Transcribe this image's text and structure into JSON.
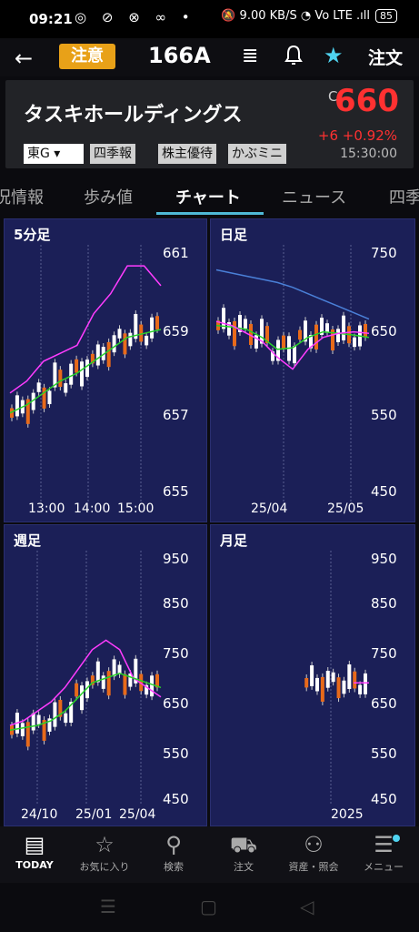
{
  "status_bar": {
    "time": "09:21",
    "left_icons": "◎ ⊘ ⊗ ∞ •",
    "right_icons": "🔕 9.00 KB/S ◔ Vo LTE .ıll",
    "battery": "85"
  },
  "header": {
    "back_glyph": "←",
    "badge": "注意",
    "code": "166A",
    "order": "注文",
    "doc_glyph": "≣",
    "bell_glyph": "♫",
    "star_glyph": "★"
  },
  "quote": {
    "name": "タスキホールディングス",
    "price_prefix": "C",
    "price": "660",
    "change": "+6  +0.92%",
    "time": "15:30:00",
    "tags": [
      "東G ▾",
      "四季報",
      "株主優待",
      "かぶミニ"
    ]
  },
  "tabs": [
    {
      "label": "況情報"
    },
    {
      "label": "歩み値"
    },
    {
      "label": "チャート"
    },
    {
      "label": "ニュース"
    },
    {
      "label": "四季"
    }
  ],
  "charts": [
    {
      "title": "5分足",
      "y_ticks": [
        "661",
        "659",
        "657",
        "655"
      ],
      "x_ticks": [
        "13:00",
        "14:00",
        "15:00"
      ]
    },
    {
      "title": "日足",
      "y_ticks": [
        "750",
        "650",
        "550",
        "450"
      ],
      "x_ticks": [
        "25/04",
        "25/05"
      ]
    },
    {
      "title": "週足",
      "y_ticks": [
        "950",
        "850",
        "750",
        "650",
        "550",
        "450"
      ],
      "x_ticks": [
        "24/10",
        "25/01",
        "25/04"
      ]
    },
    {
      "title": "月足",
      "y_ticks": [
        "950",
        "850",
        "750",
        "650",
        "550",
        "450"
      ],
      "x_ticks": [
        "2025"
      ]
    }
  ],
  "chart_data": [
    {
      "type": "line",
      "title": "5分足",
      "ylim": [
        655,
        661
      ],
      "series": [
        {
          "values": [
            657.5,
            657.8,
            658.3,
            658.5,
            658.7,
            659.5,
            660.0,
            660.7,
            660.7,
            660.2
          ]
        },
        {
          "values": [
            657.0,
            657.2,
            657.5,
            657.8,
            658.0,
            658.3,
            658.6,
            658.9,
            659.0,
            659.1
          ]
        }
      ]
    },
    {
      "type": "line",
      "title": "日足",
      "ylim": [
        450,
        750
      ],
      "series": [
        {
          "values": [
            730,
            726,
            722,
            718,
            714,
            708,
            700,
            692,
            684,
            676,
            668
          ]
        },
        {
          "values": [
            660,
            658,
            655,
            645,
            630,
            632,
            645,
            652,
            650,
            648,
            645
          ]
        },
        {
          "values": [
            665,
            660,
            650,
            640,
            620,
            605,
            630,
            645,
            650,
            652,
            650
          ]
        }
      ]
    },
    {
      "type": "line",
      "title": "週足",
      "ylim": [
        450,
        950
      ],
      "series": [
        {
          "values": [
            600,
            610,
            630,
            650,
            680,
            720,
            760,
            780,
            760,
            700,
            680,
            660
          ]
        },
        {
          "values": [
            590,
            595,
            600,
            610,
            630,
            660,
            690,
            700,
            710,
            700,
            690,
            680
          ]
        }
      ]
    },
    {
      "type": "line",
      "title": "月足",
      "ylim": [
        450,
        950
      ],
      "series": [
        {
          "values": [
            690,
            690
          ]
        }
      ]
    }
  ],
  "bottom_nav": [
    {
      "icon": "today-icon",
      "glyph": "▤",
      "label": "TODAY"
    },
    {
      "icon": "star-outline-icon",
      "glyph": "☆",
      "label": "お気に入り"
    },
    {
      "icon": "search-icon",
      "glyph": "⚲",
      "label": "検索"
    },
    {
      "icon": "cart-icon",
      "glyph": "⛟",
      "label": "注文"
    },
    {
      "icon": "person-icon",
      "glyph": "⚇",
      "label": "資産・照会"
    },
    {
      "icon": "menu-icon",
      "glyph": "☰",
      "label": "メニュー"
    }
  ],
  "system_nav": {
    "recent": "☰",
    "home": "▢",
    "back": "◁"
  },
  "colors": {
    "panel": "#1b1f57",
    "up": "#ffffff",
    "down": "#e86a1a",
    "ma_short": "#ff3cff",
    "ma_mid": "#28d128",
    "ma_long": "#4a80d8",
    "price_up": "#ff3131",
    "accent": "#4fb9d6",
    "badge": "#e8a118"
  }
}
